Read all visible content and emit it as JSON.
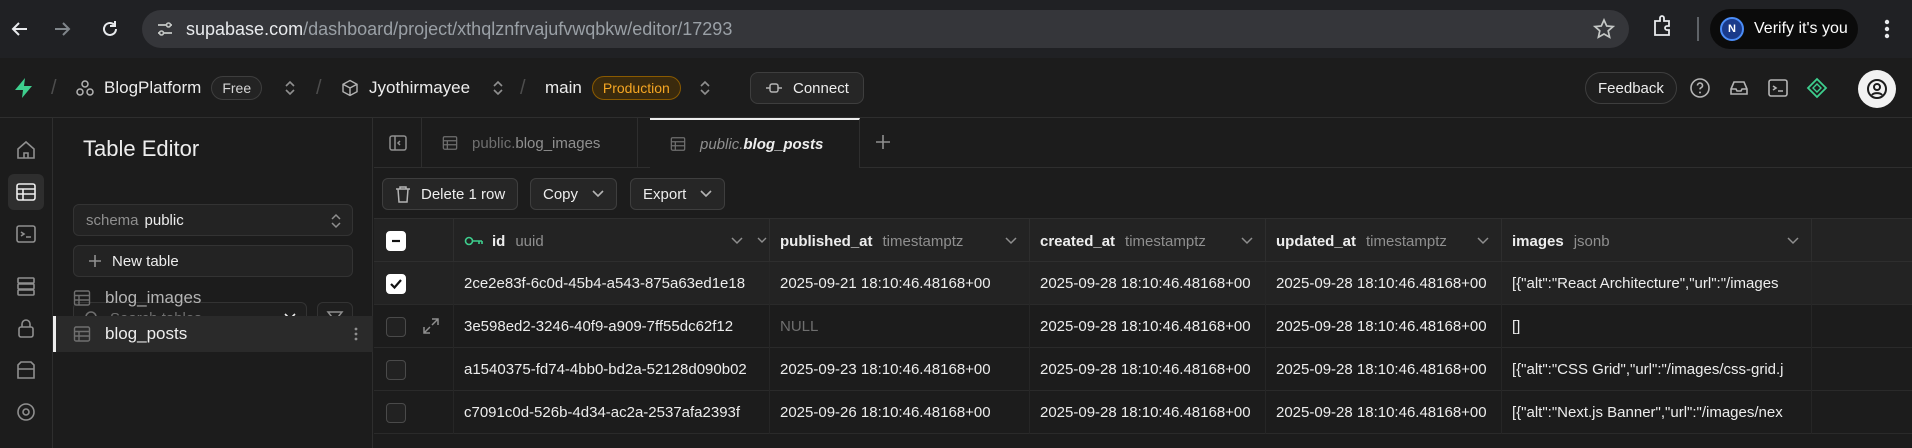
{
  "browser": {
    "url_host": "supabase.com",
    "url_path": "/dashboard/project/xthqlznfrvajufvwqbkw/editor/17293",
    "verify_label": "Verify it's you",
    "profile_initial": "N"
  },
  "topbar": {
    "org_name": "BlogPlatform",
    "org_plan": "Free",
    "project_name": "Jyothirmayee",
    "branch_name": "main",
    "branch_env": "Production",
    "connect_label": "Connect",
    "feedback_label": "Feedback"
  },
  "sidebar": {
    "title": "Table Editor",
    "schema_label": "schema",
    "schema_value": "public",
    "new_table_label": "New table",
    "search_placeholder": "Search tables...",
    "tables": [
      {
        "name": "blog_images"
      },
      {
        "name": "blog_posts"
      }
    ]
  },
  "tabs": [
    {
      "schema": "public.",
      "name": "blog_images"
    },
    {
      "schema": "public.",
      "name": "blog_posts"
    }
  ],
  "toolbar": {
    "delete_label": "Delete 1 row",
    "copy_label": "Copy",
    "export_label": "Export"
  },
  "grid": {
    "columns": [
      {
        "name": "id",
        "type": "uuid"
      },
      {
        "name": "published_at",
        "type": "timestamptz"
      },
      {
        "name": "created_at",
        "type": "timestamptz"
      },
      {
        "name": "updated_at",
        "type": "timestamptz"
      },
      {
        "name": "images",
        "type": "jsonb"
      }
    ],
    "rows": [
      {
        "id": "2ce2e83f-6c0d-45b4-a543-875a63ed1e18",
        "published_at": "2025-09-21 18:10:46.48168+00",
        "created_at": "2025-09-28 18:10:46.48168+00",
        "updated_at": "2025-09-28 18:10:46.48168+00",
        "images": "[{\"alt\":\"React Architecture\",\"url\":\"/images"
      },
      {
        "id": "3e598ed2-3246-40f9-a909-7ff55dc62f12",
        "published_at": "NULL",
        "created_at": "2025-09-28 18:10:46.48168+00",
        "updated_at": "2025-09-28 18:10:46.48168+00",
        "images": "[]"
      },
      {
        "id": "a1540375-fd74-4bb0-bd2a-52128d090b02",
        "published_at": "2025-09-23 18:10:46.48168+00",
        "created_at": "2025-09-28 18:10:46.48168+00",
        "updated_at": "2025-09-28 18:10:46.48168+00",
        "images": "[{\"alt\":\"CSS Grid\",\"url\":\"/images/css-grid.j"
      },
      {
        "id": "c7091c0d-526b-4d34-ac2a-2537afa2393f",
        "published_at": "2025-09-26 18:10:46.48168+00",
        "created_at": "2025-09-28 18:10:46.48168+00",
        "updated_at": "2025-09-28 18:10:46.48168+00",
        "images": "[{\"alt\":\"Next.js Banner\",\"url\":\"/images/nex"
      }
    ]
  },
  "colors": {
    "brand": "#3ecf8e",
    "production": "#f5a623",
    "background": "#1c1c1c"
  }
}
